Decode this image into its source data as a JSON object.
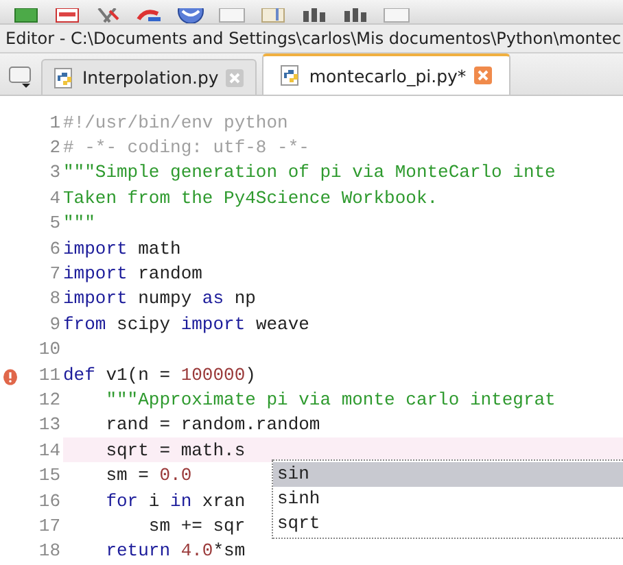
{
  "toolbar": {
    "buttons": [
      {
        "kind": "green"
      },
      {
        "kind": "red"
      },
      {
        "kind": "cut"
      },
      {
        "kind": "undo"
      },
      {
        "kind": "globe"
      },
      {
        "kind": "blank"
      },
      {
        "kind": "doc"
      },
      {
        "kind": "chart"
      },
      {
        "kind": "chart"
      },
      {
        "kind": "blank"
      }
    ]
  },
  "window": {
    "title": "Editor - C:\\Documents and Settings\\carlos\\Mis documentos\\Python\\montec"
  },
  "tabs": [
    {
      "label": "Interpolation.py",
      "selected": false
    },
    {
      "label": "montecarlo_pi.py*",
      "selected": true
    }
  ],
  "editor": {
    "lines": [
      {
        "number": "1",
        "tokens": [
          {
            "text": "#!/usr/bin/env python",
            "kind": "comment"
          }
        ]
      },
      {
        "number": "2",
        "tokens": [
          {
            "text": "# -*- coding: utf-8 -*-",
            "kind": "comment"
          }
        ]
      },
      {
        "number": "3",
        "tokens": [
          {
            "text": "\"\"\"Simple generation of pi via MonteCarlo inte",
            "kind": "string"
          }
        ]
      },
      {
        "number": "4",
        "tokens": [
          {
            "text": "Taken from the Py4Science Workbook.",
            "kind": "string"
          }
        ]
      },
      {
        "number": "5",
        "tokens": [
          {
            "text": "\"\"\"",
            "kind": "string"
          }
        ]
      },
      {
        "number": "6",
        "tokens": [
          {
            "text": "import",
            "kind": "keyword"
          },
          {
            "text": " math",
            "kind": "plain"
          }
        ]
      },
      {
        "number": "7",
        "tokens": [
          {
            "text": "import",
            "kind": "keyword"
          },
          {
            "text": " random",
            "kind": "plain"
          }
        ]
      },
      {
        "number": "8",
        "tokens": [
          {
            "text": "import",
            "kind": "keyword"
          },
          {
            "text": " numpy ",
            "kind": "plain"
          },
          {
            "text": "as",
            "kind": "keyword"
          },
          {
            "text": " np",
            "kind": "plain"
          }
        ]
      },
      {
        "number": "9",
        "tokens": [
          {
            "text": "from",
            "kind": "keyword"
          },
          {
            "text": " scipy ",
            "kind": "plain"
          },
          {
            "text": "import",
            "kind": "keyword"
          },
          {
            "text": " weave",
            "kind": "plain"
          }
        ]
      },
      {
        "number": "10"
      },
      {
        "number": "11",
        "error": true,
        "tokens": [
          {
            "text": "def",
            "kind": "keyword"
          },
          {
            "text": " v1(n = ",
            "kind": "plain"
          },
          {
            "text": "100000",
            "kind": "number"
          },
          {
            "text": ")",
            "kind": "plain"
          }
        ]
      },
      {
        "number": "12",
        "tokens": [
          {
            "text": "    \"\"\"Approximate pi via monte carlo integrat",
            "kind": "string"
          }
        ]
      },
      {
        "number": "13",
        "tokens": [
          {
            "text": "    rand = random.random",
            "kind": "plain"
          }
        ]
      },
      {
        "number": "14",
        "current": true,
        "tokens": [
          {
            "text": "    sqrt = math.s",
            "kind": "plain"
          }
        ]
      },
      {
        "number": "15",
        "tokens": [
          {
            "text": "    sm = ",
            "kind": "plain"
          },
          {
            "text": "0.0",
            "kind": "number"
          }
        ]
      },
      {
        "number": "16",
        "tokens": [
          {
            "text": "    for",
            "kind": "keyword"
          },
          {
            "text": " i ",
            "kind": "plain"
          },
          {
            "text": "in",
            "kind": "keyword"
          },
          {
            "text": " xran",
            "kind": "plain"
          }
        ]
      },
      {
        "number": "17",
        "tokens": [
          {
            "text": "        sm += sqr",
            "kind": "plain"
          }
        ]
      },
      {
        "number": "18",
        "tokens": [
          {
            "text": "    return",
            "kind": "keyword"
          },
          {
            "text": " 4.0",
            "kind": "number"
          },
          {
            "text": "*sm",
            "kind": "plain"
          }
        ]
      }
    ]
  },
  "completion": {
    "items": [
      {
        "label": "sin",
        "selected": true
      },
      {
        "label": "sinh",
        "selected": false
      },
      {
        "label": "sqrt",
        "selected": false
      }
    ]
  }
}
